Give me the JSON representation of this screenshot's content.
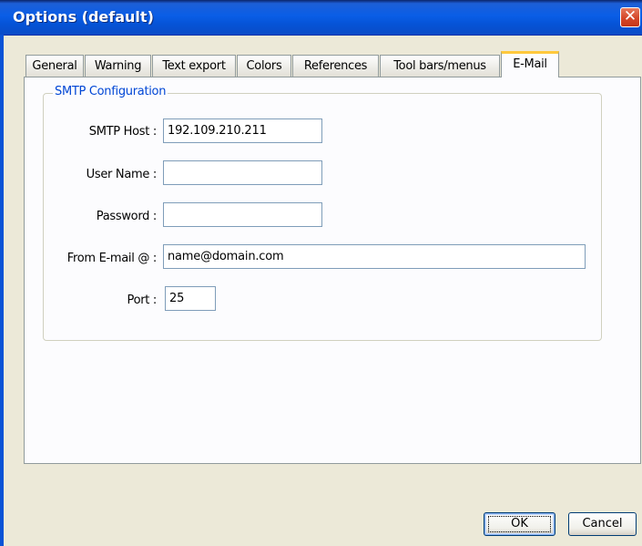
{
  "window": {
    "title": "Options (default)",
    "close_glyph": "✕"
  },
  "tabs": [
    {
      "label": "General"
    },
    {
      "label": "Warning"
    },
    {
      "label": "Text export"
    },
    {
      "label": "Colors"
    },
    {
      "label": "References"
    },
    {
      "label": "Tool bars/menus"
    },
    {
      "label": "E-Mail",
      "active": true
    }
  ],
  "smtp": {
    "group_title": "SMTP Configuration",
    "host_label": "SMTP Host :",
    "host_value": "192.109.210.211",
    "user_label": "User Name :",
    "user_value": "",
    "password_label": "Password :",
    "password_value": "",
    "from_label": "From E-mail @ :",
    "from_value": "name@domain.com",
    "port_label": "Port :",
    "port_value": "25"
  },
  "buttons": {
    "ok_label": "OK",
    "cancel_label": "Cancel"
  },
  "colors": {
    "titlebar": "#0a5ee7",
    "group_title": "#0046d5",
    "active_tab_accent": "#ffc83c"
  }
}
